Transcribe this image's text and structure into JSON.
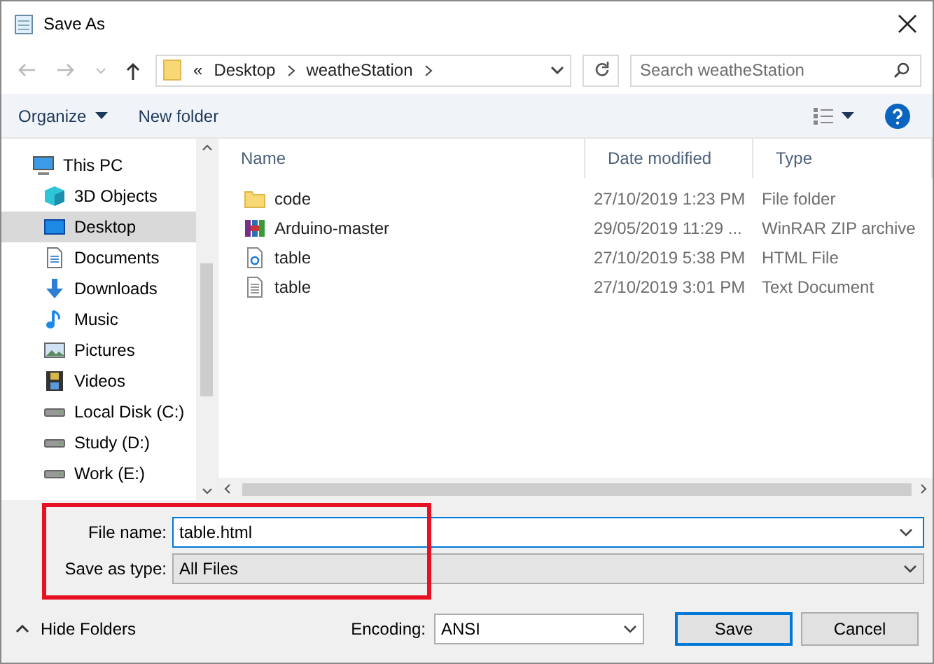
{
  "window": {
    "title": "Save As"
  },
  "address": {
    "overflow": "«",
    "crumbs": [
      "Desktop",
      "weatheStation"
    ]
  },
  "search": {
    "placeholder": "Search weatheStation"
  },
  "toolbar": {
    "organize": "Organize",
    "new_folder": "New folder"
  },
  "sidebar": {
    "items": [
      {
        "label": "This PC",
        "selected": false,
        "children": [
          {
            "label": "3D Objects",
            "selected": false
          },
          {
            "label": "Desktop",
            "selected": true
          },
          {
            "label": "Documents",
            "selected": false
          },
          {
            "label": "Downloads",
            "selected": false
          },
          {
            "label": "Music",
            "selected": false
          },
          {
            "label": "Pictures",
            "selected": false
          },
          {
            "label": "Videos",
            "selected": false
          },
          {
            "label": "Local Disk (C:)",
            "selected": false
          },
          {
            "label": "Study (D:)",
            "selected": false
          },
          {
            "label": "Work (E:)",
            "selected": false
          }
        ]
      }
    ]
  },
  "table": {
    "columns": [
      "Name",
      "Date modified",
      "Type"
    ],
    "rows": [
      {
        "name": "code",
        "date": "27/10/2019 1:23 PM",
        "type": "File folder"
      },
      {
        "name": "Arduino-master",
        "date": "29/05/2019 11:29 ...",
        "type": "WinRAR ZIP archive"
      },
      {
        "name": "table",
        "date": "27/10/2019 5:38 PM",
        "type": "HTML File"
      },
      {
        "name": "table",
        "date": "27/10/2019 3:01 PM",
        "type": "Text Document"
      }
    ]
  },
  "file_name": {
    "label": "File name:",
    "value": "table.html"
  },
  "save_as_type": {
    "label": "Save as type:",
    "value": "All Files"
  },
  "encoding": {
    "label": "Encoding:",
    "value": "ANSI"
  },
  "hide_folders": "Hide Folders",
  "buttons": [
    "Save",
    "Cancel"
  ]
}
